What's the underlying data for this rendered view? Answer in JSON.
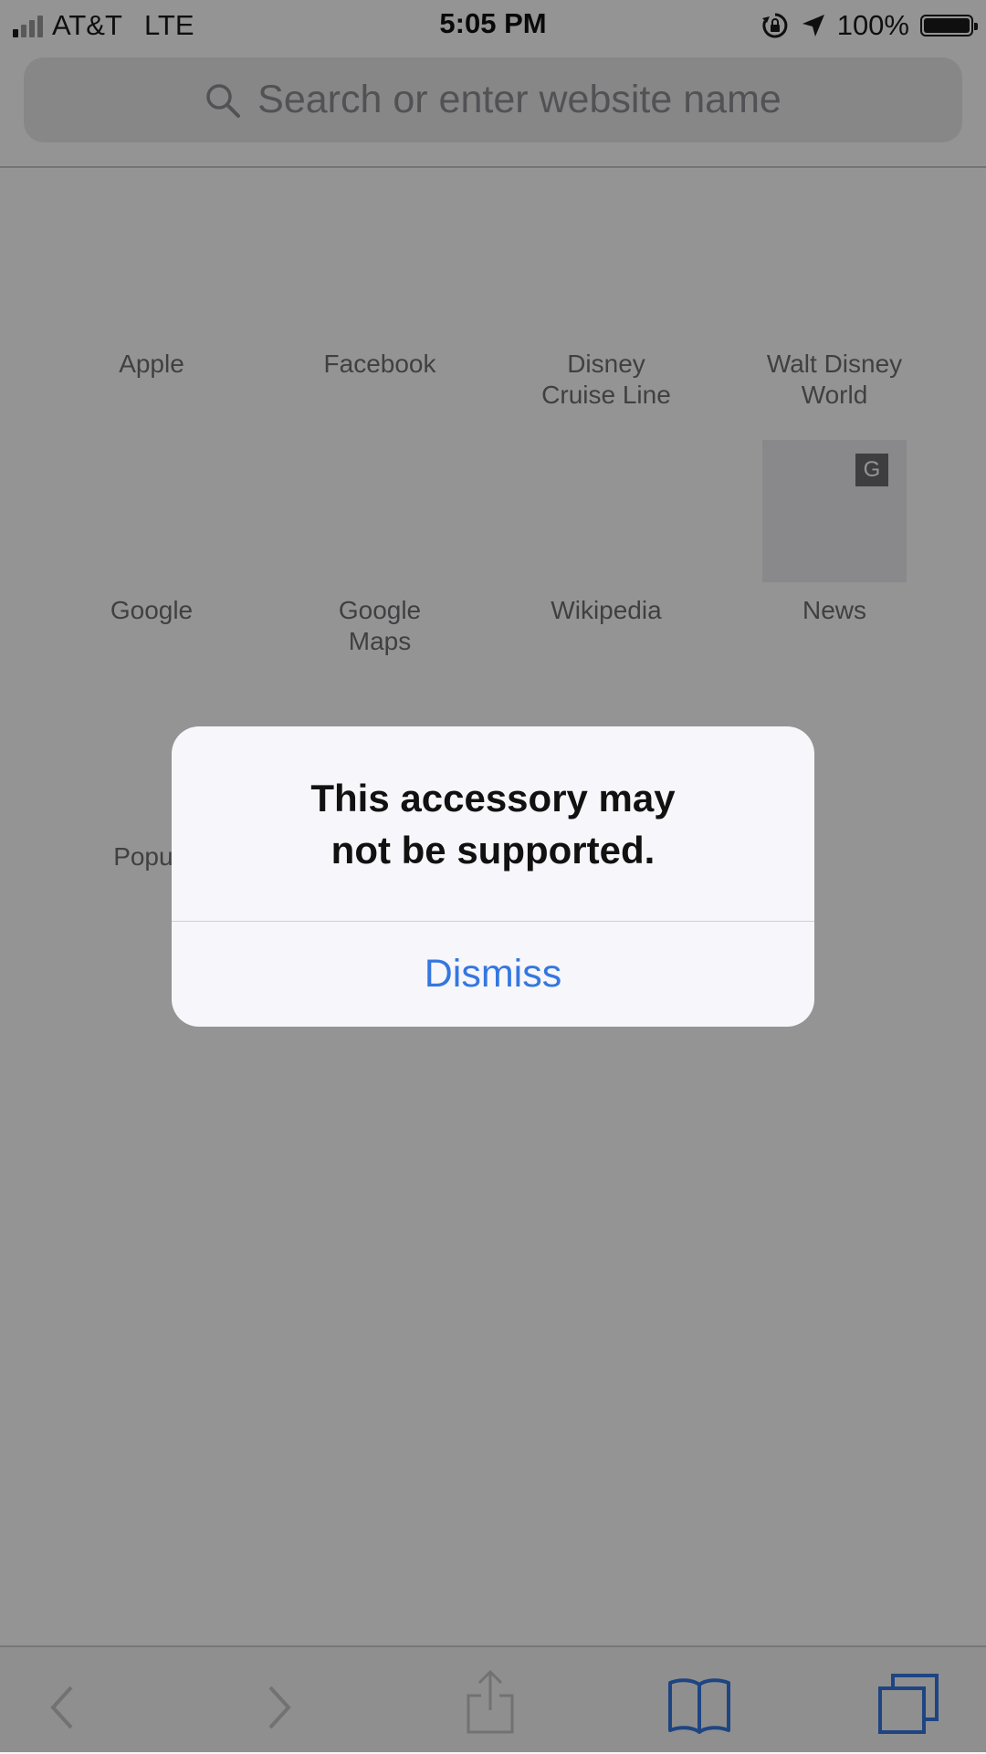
{
  "status_bar": {
    "carrier": "AT&T",
    "network": "LTE",
    "time": "5:05 PM",
    "battery": "100%",
    "battery_level": 1.0
  },
  "search": {
    "placeholder": "Search or enter website name"
  },
  "favorites": [
    {
      "label": "Apple"
    },
    {
      "label": "Facebook"
    },
    {
      "label": "Disney\nCruise Line"
    },
    {
      "label": "Walt Disney\nWorld"
    },
    {
      "label": "Google"
    },
    {
      "label": "Google\nMaps"
    },
    {
      "label": "Wikipedia"
    },
    {
      "label": "News",
      "tile_letter": "G"
    },
    {
      "label": "Popul"
    }
  ],
  "alert": {
    "title": "This accessory may\nnot be supported.",
    "dismiss_label": "Dismiss"
  },
  "colors": {
    "accent": "#3477e0",
    "overlay": "#000000"
  }
}
